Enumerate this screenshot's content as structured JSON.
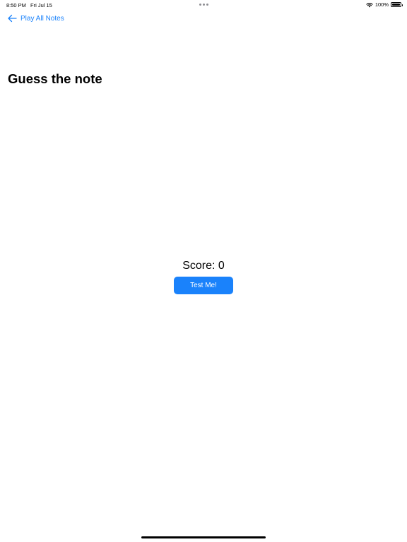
{
  "status_bar": {
    "time": "8:50 PM",
    "date": "Fri Jul 15",
    "battery_percent": "100%",
    "battery_level": 1.0,
    "icons": [
      "wifi-icon",
      "battery-icon"
    ]
  },
  "nav": {
    "back_label": "Play All Notes",
    "back_icon": "arrow-left-icon"
  },
  "page": {
    "title": "Guess the note"
  },
  "score": {
    "label": "Score:",
    "value": "0"
  },
  "actions": {
    "test_label": "Test Me!"
  },
  "colors": {
    "accent": "#1a82fb",
    "background": "#ffffff",
    "text": "#000000"
  }
}
